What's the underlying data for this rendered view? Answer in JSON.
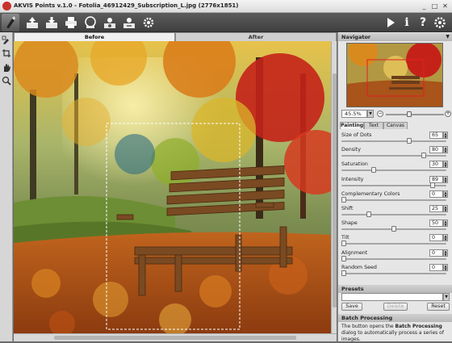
{
  "window": {
    "title": "AKVIS Points v.1.0 - Fotolia_46912429_Subscription_L.jpg (2776x1851)",
    "minimize": "_",
    "maximize": "□",
    "close": "✕"
  },
  "toolbar": {
    "buttons": [
      "open-icon",
      "save-icon",
      "print-icon",
      "share-icon",
      "batch-icon",
      "presets-icon",
      "settings-icon"
    ],
    "right_buttons": [
      "run-icon",
      "info-icon",
      "help-icon",
      "preferences-icon"
    ],
    "help_label": "?",
    "info_label": "i"
  },
  "canvas": {
    "tabs": {
      "before": "Before",
      "after": "After"
    },
    "active_tab": "before"
  },
  "navigator": {
    "title": "Navigator",
    "zoom": "45.5%",
    "zoom_minus": "−",
    "zoom_plus": "+",
    "zoom_level": 0.4
  },
  "panel_tabs": {
    "painting": "Painting",
    "text": "Text",
    "canvas": "Canvas"
  },
  "params": [
    {
      "label": "Size of Dots",
      "value": "65",
      "level": 0.65
    },
    {
      "label": "Density",
      "value": "80",
      "level": 0.8
    },
    {
      "label": "Saturation",
      "value": "30",
      "level": 0.3
    },
    {
      "label": "Intensity",
      "value": "89",
      "level": 0.89
    },
    {
      "label": "Complementary Colors",
      "value": "0",
      "level": 0.0
    },
    {
      "label": "Shift",
      "value": "25",
      "level": 0.25
    },
    {
      "label": "Shape",
      "value": "50",
      "level": 0.5
    },
    {
      "label": "Tilt",
      "value": "0",
      "level": 0.0
    },
    {
      "label": "Alignment",
      "value": "0",
      "level": 0.0
    },
    {
      "label": "Random Seed",
      "value": "0",
      "level": 0.0
    }
  ],
  "presets": {
    "title": "Presets",
    "save": "Save",
    "delete": "Delete",
    "reset": "Reset"
  },
  "batch": {
    "title": "Batch Processing",
    "text_before": "The button opens the ",
    "text_bold": "Batch Processing",
    "text_after": " dialog to automatically process a series of images."
  },
  "colors": {
    "toolbar": "#4a4a4a",
    "panel": "#e6e6e6",
    "accent": "#c8322b"
  }
}
